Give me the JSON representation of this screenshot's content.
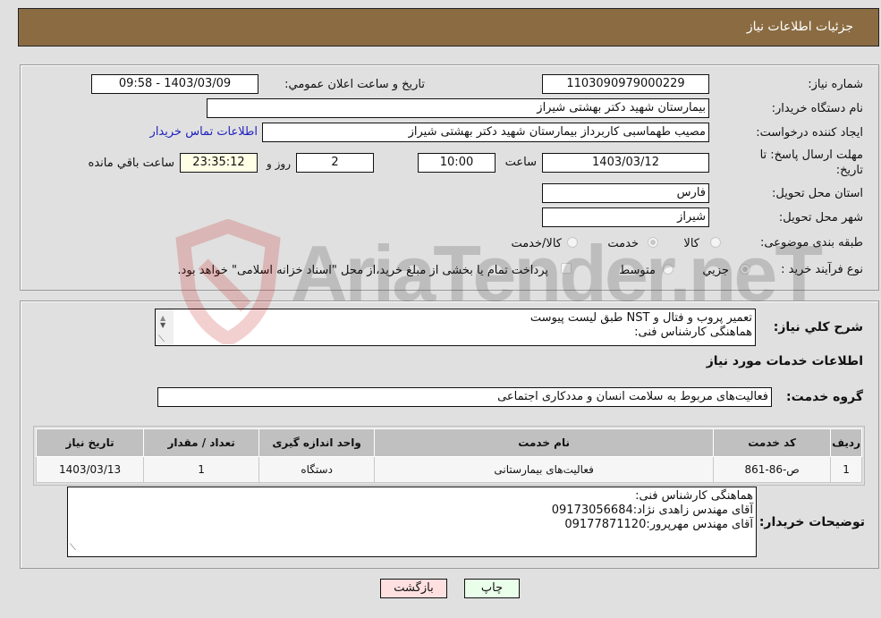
{
  "header": {
    "title": "جزئيات اطلاعات نياز"
  },
  "details": {
    "need_number_label": "شماره نياز:",
    "need_number": "1103090979000229",
    "announce_label": "تاريخ و ساعت اعلان عمومي:",
    "announce_value": "1403/03/09 - 09:58",
    "buyer_org_label": "نام دستگاه خريدار:",
    "buyer_org": "بيمارستان شهيد دكتر بهشتی شيراز",
    "requester_label": "ايجاد كننده درخواست:",
    "requester": "مصيب طهماسبی كاربرداز بيمارستان شهيد دكتر بهشتی شيراز",
    "contact_link": "اطلاعات تماس خريدار",
    "deadline_label_1": "مهلت ارسال پاسخ: تا",
    "deadline_label_2": "تاريخ:",
    "deadline_date": "1403/03/12",
    "time_label": "ساعت",
    "deadline_time": "10:00",
    "days_value": "2",
    "days_label": "روز و",
    "remaining_time": "23:35:12",
    "remaining_label": "ساعت باقي مانده",
    "province_label": "استان محل تحويل:",
    "province": "فارس",
    "city_label": "شهر محل تحويل:",
    "city": "شيراز",
    "category_label": "طبقه بندی موضوعی:",
    "category_options": [
      {
        "label": "كالا",
        "selected": false
      },
      {
        "label": "خدمت",
        "selected": true
      },
      {
        "label": "كالا/خدمت",
        "selected": false
      }
    ],
    "process_label": "نوع فرآيند خريد :",
    "process_options": [
      {
        "label": "جزيي",
        "selected": true
      },
      {
        "label": "متوسط",
        "selected": false
      }
    ],
    "treasury_note": "پرداخت تمام يا بخشی از مبلغ خريد،از محل \"اسناد خزانه اسلامی\" خواهد بود."
  },
  "summary": {
    "label": "شرح كلي نياز:",
    "line1": "تعمير پروب و فتال و NST طبق ليست پيوست",
    "line2": "هماهنگی كارشناس فنی:",
    "services_heading": "اطلاعات خدمات مورد نياز",
    "service_group_label": "گروه خدمت:",
    "service_group": "فعاليت‌های مربوط به سلامت انسان و مددكاری اجتماعی"
  },
  "table": {
    "headers": [
      "رديف",
      "كد خدمت",
      "نام خدمت",
      "واحد اندازه گيری",
      "تعداد / مقدار",
      "تاريخ نياز"
    ],
    "rows": [
      [
        "1",
        "ص-86-861",
        "فعاليت‌های بيمارستانی",
        "دستگاه",
        "1",
        "1403/03/13"
      ]
    ]
  },
  "buyer_notes": {
    "label": "توضيحات خريدار:",
    "line1": "هماهنگی كارشناس فنی:",
    "line2": "آقای مهندس زاهدی نژاد:09173056684",
    "line3": "آقای مهندس مهرپرور:09177871120"
  },
  "buttons": {
    "print": "چاپ",
    "back": "بازگشت"
  },
  "watermark": {
    "text": "AriaTender.neT"
  },
  "colors": {
    "header_bg": "#8b6c42",
    "print_bg": "#eaffea",
    "back_bg": "#ffe0e0",
    "link": "#2020c0"
  }
}
